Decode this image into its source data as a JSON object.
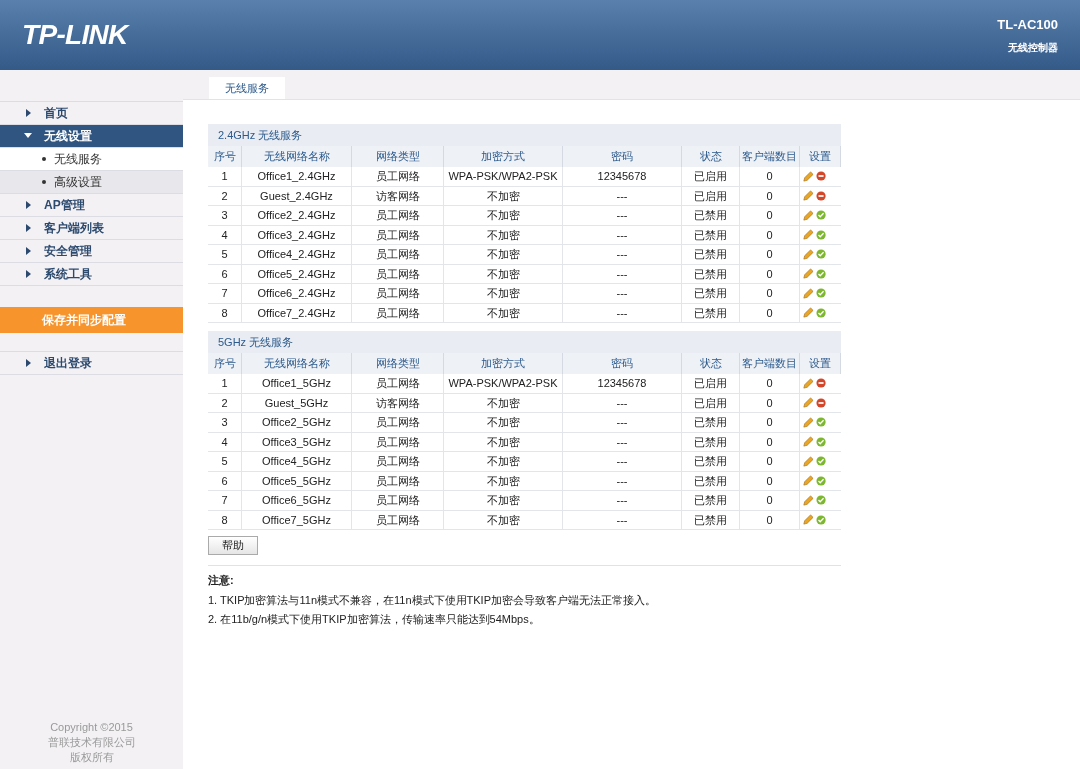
{
  "header": {
    "logo": "TP-LINK",
    "model": "TL-AC100",
    "subtitle": "无线控制器"
  },
  "sidebar": {
    "items": [
      {
        "label": "首页",
        "expanded": false,
        "selected": false
      },
      {
        "label": "无线设置",
        "expanded": true,
        "selected": true,
        "children": [
          {
            "label": "无线服务",
            "selected": true
          },
          {
            "label": "高级设置",
            "selected": false
          }
        ]
      },
      {
        "label": "AP管理",
        "expanded": false,
        "selected": false
      },
      {
        "label": "客户端列表",
        "expanded": false,
        "selected": false
      },
      {
        "label": "安全管理",
        "expanded": false,
        "selected": false
      },
      {
        "label": "系统工具",
        "expanded": false,
        "selected": false
      }
    ],
    "save_button": "保存并同步配置",
    "bottom_items": [
      {
        "label": "退出登录",
        "expanded": false,
        "selected": false
      }
    ],
    "copyright": [
      "Copyright ©2015",
      "普联技术有限公司",
      "版权所有"
    ]
  },
  "tabs": [
    {
      "label": "无线服务",
      "selected": true
    }
  ],
  "sections": [
    {
      "title": "2.4GHz 无线服务",
      "columns": [
        "序号",
        "无线网络名称",
        "网络类型",
        "加密方式",
        "密码",
        "状态",
        "客户端数目",
        "设置"
      ],
      "rows": [
        {
          "cells": [
            "1",
            "Office1_2.4GHz",
            "员工网络",
            "WPA-PSK/WPA2-PSK",
            "12345678",
            "已启用",
            "0"
          ],
          "enabled": true
        },
        {
          "cells": [
            "2",
            "Guest_2.4GHz",
            "访客网络",
            "不加密",
            "---",
            "已启用",
            "0"
          ],
          "enabled": true
        },
        {
          "cells": [
            "3",
            "Office2_2.4GHz",
            "员工网络",
            "不加密",
            "---",
            "已禁用",
            "0"
          ],
          "enabled": false
        },
        {
          "cells": [
            "4",
            "Office3_2.4GHz",
            "员工网络",
            "不加密",
            "---",
            "已禁用",
            "0"
          ],
          "enabled": false
        },
        {
          "cells": [
            "5",
            "Office4_2.4GHz",
            "员工网络",
            "不加密",
            "---",
            "已禁用",
            "0"
          ],
          "enabled": false
        },
        {
          "cells": [
            "6",
            "Office5_2.4GHz",
            "员工网络",
            "不加密",
            "---",
            "已禁用",
            "0"
          ],
          "enabled": false
        },
        {
          "cells": [
            "7",
            "Office6_2.4GHz",
            "员工网络",
            "不加密",
            "---",
            "已禁用",
            "0"
          ],
          "enabled": false
        },
        {
          "cells": [
            "8",
            "Office7_2.4GHz",
            "员工网络",
            "不加密",
            "---",
            "已禁用",
            "0"
          ],
          "enabled": false
        }
      ]
    },
    {
      "title": "5GHz 无线服务",
      "columns": [
        "序号",
        "无线网络名称",
        "网络类型",
        "加密方式",
        "密码",
        "状态",
        "客户端数目",
        "设置"
      ],
      "rows": [
        {
          "cells": [
            "1",
            "Office1_5GHz",
            "员工网络",
            "WPA-PSK/WPA2-PSK",
            "12345678",
            "已启用",
            "0"
          ],
          "enabled": true
        },
        {
          "cells": [
            "2",
            "Guest_5GHz",
            "访客网络",
            "不加密",
            "---",
            "已启用",
            "0"
          ],
          "enabled": true
        },
        {
          "cells": [
            "3",
            "Office2_5GHz",
            "员工网络",
            "不加密",
            "---",
            "已禁用",
            "0"
          ],
          "enabled": false
        },
        {
          "cells": [
            "4",
            "Office3_5GHz",
            "员工网络",
            "不加密",
            "---",
            "已禁用",
            "0"
          ],
          "enabled": false
        },
        {
          "cells": [
            "5",
            "Office4_5GHz",
            "员工网络",
            "不加密",
            "---",
            "已禁用",
            "0"
          ],
          "enabled": false
        },
        {
          "cells": [
            "6",
            "Office5_5GHz",
            "员工网络",
            "不加密",
            "---",
            "已禁用",
            "0"
          ],
          "enabled": false
        },
        {
          "cells": [
            "7",
            "Office6_5GHz",
            "员工网络",
            "不加密",
            "---",
            "已禁用",
            "0"
          ],
          "enabled": false
        },
        {
          "cells": [
            "8",
            "Office7_5GHz",
            "员工网络",
            "不加密",
            "---",
            "已禁用",
            "0"
          ],
          "enabled": false
        }
      ]
    }
  ],
  "help_button": "帮助",
  "notes": {
    "title": "注意:",
    "lines": [
      "1. TKIP加密算法与11n模式不兼容，在11n模式下使用TKIP加密会导致客户端无法正常接入。",
      "2. 在11b/g/n模式下使用TKIP加密算法，传输速率只能达到54Mbps。"
    ]
  }
}
